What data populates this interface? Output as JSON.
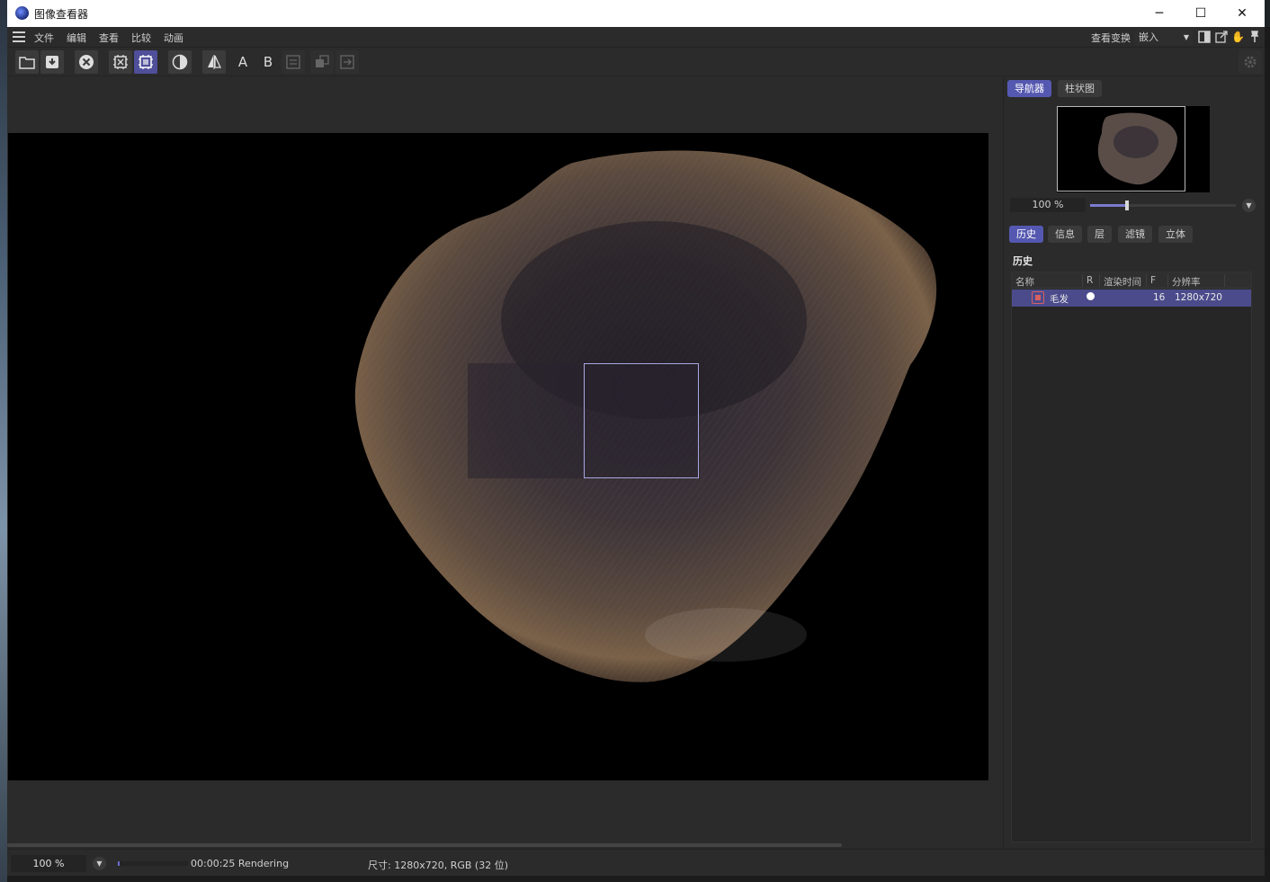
{
  "window": {
    "title": "图像查看器",
    "minimize_glyph": "─",
    "maximize_glyph": "☐",
    "close_glyph": "✕"
  },
  "menu": {
    "items": [
      "文件",
      "编辑",
      "查看",
      "比较",
      "动画"
    ],
    "view_transform_label": "查看变换",
    "view_transform_value": "嵌入"
  },
  "toolbar": {
    "icons": [
      "open-file-icon",
      "save-icon",
      "stop-render-icon",
      "render-region-icon",
      "render-active-icon",
      "contrast-icon",
      "ab-compare-icon",
      "A",
      "B",
      "swap-ab-icon",
      "overlay-icon",
      "export-icon"
    ],
    "label_a": "A",
    "label_b": "B"
  },
  "navigator": {
    "tab_navigator": "导航器",
    "tab_histogram": "柱状图",
    "zoom_value": "100 %",
    "zoom_slider_fraction": 0.25
  },
  "panel_tabs": [
    "历史",
    "信息",
    "层",
    "滤镜",
    "立体"
  ],
  "history": {
    "title": "历史",
    "columns": [
      "名称",
      "R",
      "渲染时间",
      "F",
      "分辨率"
    ],
    "rows": [
      {
        "name": "毛发",
        "render_time": "",
        "frames": "16",
        "resolution": "1280x720"
      }
    ]
  },
  "status": {
    "zoom": "100 %",
    "render_progress_fraction": 0.02,
    "time_text": "00:00:25 Rendering",
    "size_text": "尺寸: 1280x720, RGB (32 位)"
  },
  "colors": {
    "accent": "#5558b0",
    "panel_bg": "#2b2b2b",
    "row_selected": "#4b4b8c"
  }
}
